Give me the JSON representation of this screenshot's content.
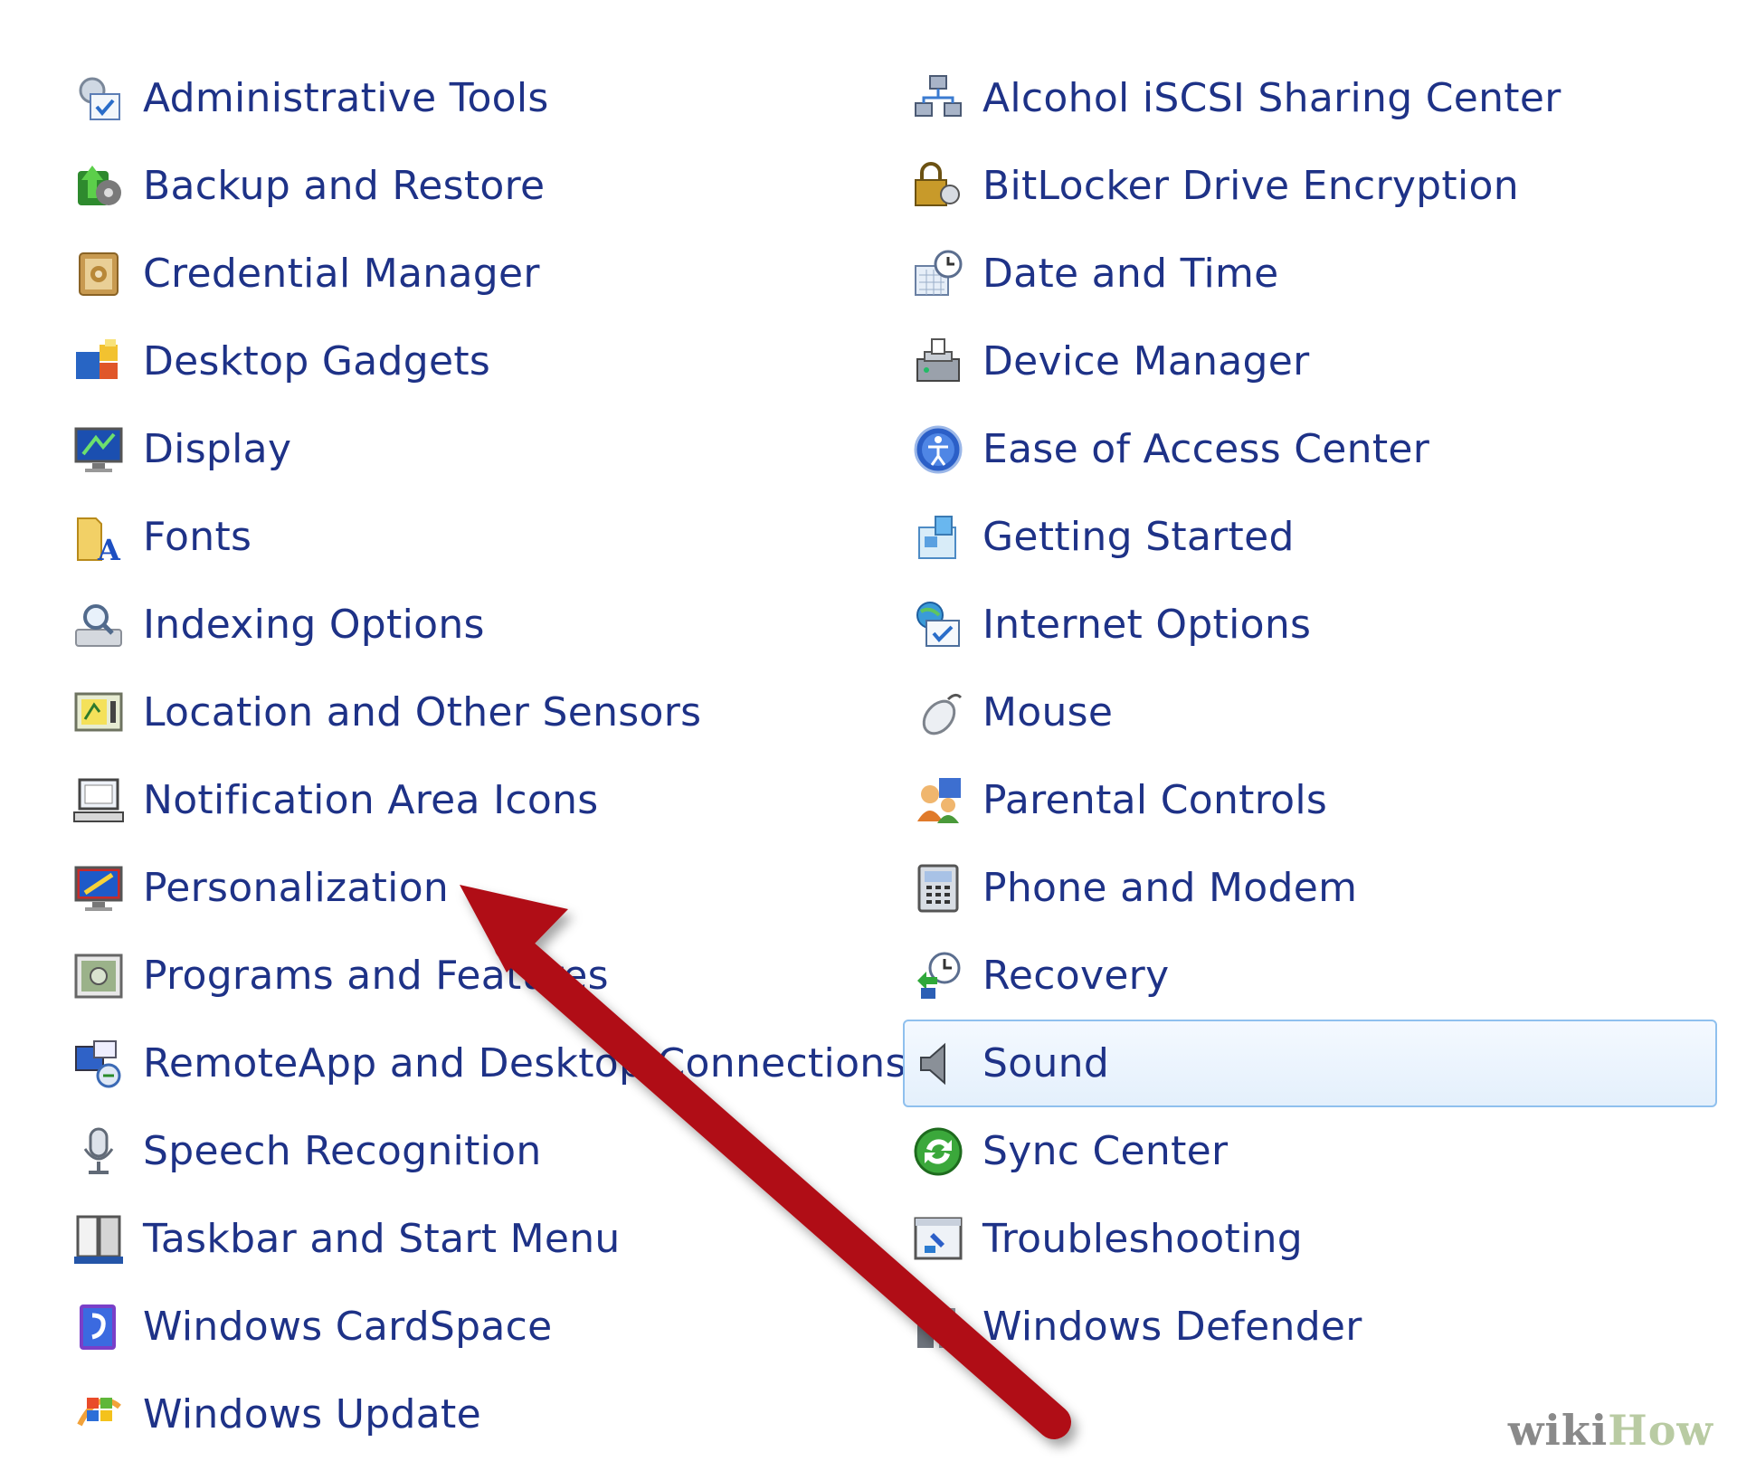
{
  "left_items": [
    {
      "label": "Administrative Tools",
      "icon": "admin-tools-icon"
    },
    {
      "label": "Backup and Restore",
      "icon": "backup-icon"
    },
    {
      "label": "Credential Manager",
      "icon": "credential-icon"
    },
    {
      "label": "Desktop Gadgets",
      "icon": "gadgets-icon"
    },
    {
      "label": "Display",
      "icon": "display-icon"
    },
    {
      "label": "Fonts",
      "icon": "fonts-icon"
    },
    {
      "label": "Indexing Options",
      "icon": "indexing-icon"
    },
    {
      "label": "Location and Other Sensors",
      "icon": "sensors-icon"
    },
    {
      "label": "Notification Area Icons",
      "icon": "notification-icon"
    },
    {
      "label": "Personalization",
      "icon": "personalization-icon"
    },
    {
      "label": "Programs and Features",
      "icon": "programs-icon"
    },
    {
      "label": "RemoteApp and Desktop Connections",
      "icon": "remoteapp-icon"
    },
    {
      "label": "Speech Recognition",
      "icon": "speech-icon"
    },
    {
      "label": "Taskbar and Start Menu",
      "icon": "taskbar-icon"
    },
    {
      "label": "Windows CardSpace",
      "icon": "cardspace-icon"
    },
    {
      "label": "Windows Update",
      "icon": "windows-update-icon"
    }
  ],
  "right_items": [
    {
      "label": "Alcohol iSCSI Sharing Center",
      "icon": "iscsi-icon"
    },
    {
      "label": "BitLocker Drive Encryption",
      "icon": "bitlocker-icon"
    },
    {
      "label": "Date and Time",
      "icon": "date-time-icon"
    },
    {
      "label": "Device Manager",
      "icon": "device-manager-icon"
    },
    {
      "label": "Ease of Access Center",
      "icon": "ease-of-access-icon"
    },
    {
      "label": "Getting Started",
      "icon": "getting-started-icon"
    },
    {
      "label": "Internet Options",
      "icon": "internet-options-icon"
    },
    {
      "label": "Mouse",
      "icon": "mouse-icon"
    },
    {
      "label": "Parental Controls",
      "icon": "parental-controls-icon"
    },
    {
      "label": "Phone and Modem",
      "icon": "phone-modem-icon"
    },
    {
      "label": "Recovery",
      "icon": "recovery-icon"
    },
    {
      "label": "Sound",
      "icon": "sound-icon",
      "selected": true
    },
    {
      "label": "Sync Center",
      "icon": "sync-icon"
    },
    {
      "label": "Troubleshooting",
      "icon": "troubleshooting-icon"
    },
    {
      "label": "Windows Defender",
      "icon": "defender-icon"
    }
  ],
  "annotation": {
    "arrow_color": "#b01018",
    "target": "Personalization"
  },
  "watermark": {
    "part1": "wiki",
    "part2": "How"
  },
  "colors": {
    "link": "#1e3287",
    "selection_border": "#8fc0ee",
    "selection_bg": "#e4f0fc"
  }
}
